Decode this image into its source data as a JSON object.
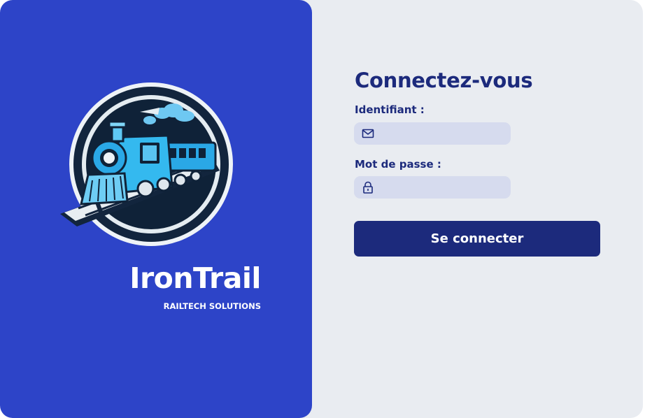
{
  "brand": {
    "name": "IronTrail",
    "tagline": "RAILTECH SOLUTIONS",
    "logo_icon": "locomotive-logo",
    "color": "#2d44c8"
  },
  "login": {
    "title": "Connectez-vous",
    "username": {
      "label": "Identifiant :",
      "value": "",
      "icon": "envelope-icon"
    },
    "password": {
      "label": "Mot de passe :",
      "value": "",
      "icon": "lock-icon"
    },
    "submit_label": "Se connecter",
    "accent_color": "#1c2a7c"
  }
}
